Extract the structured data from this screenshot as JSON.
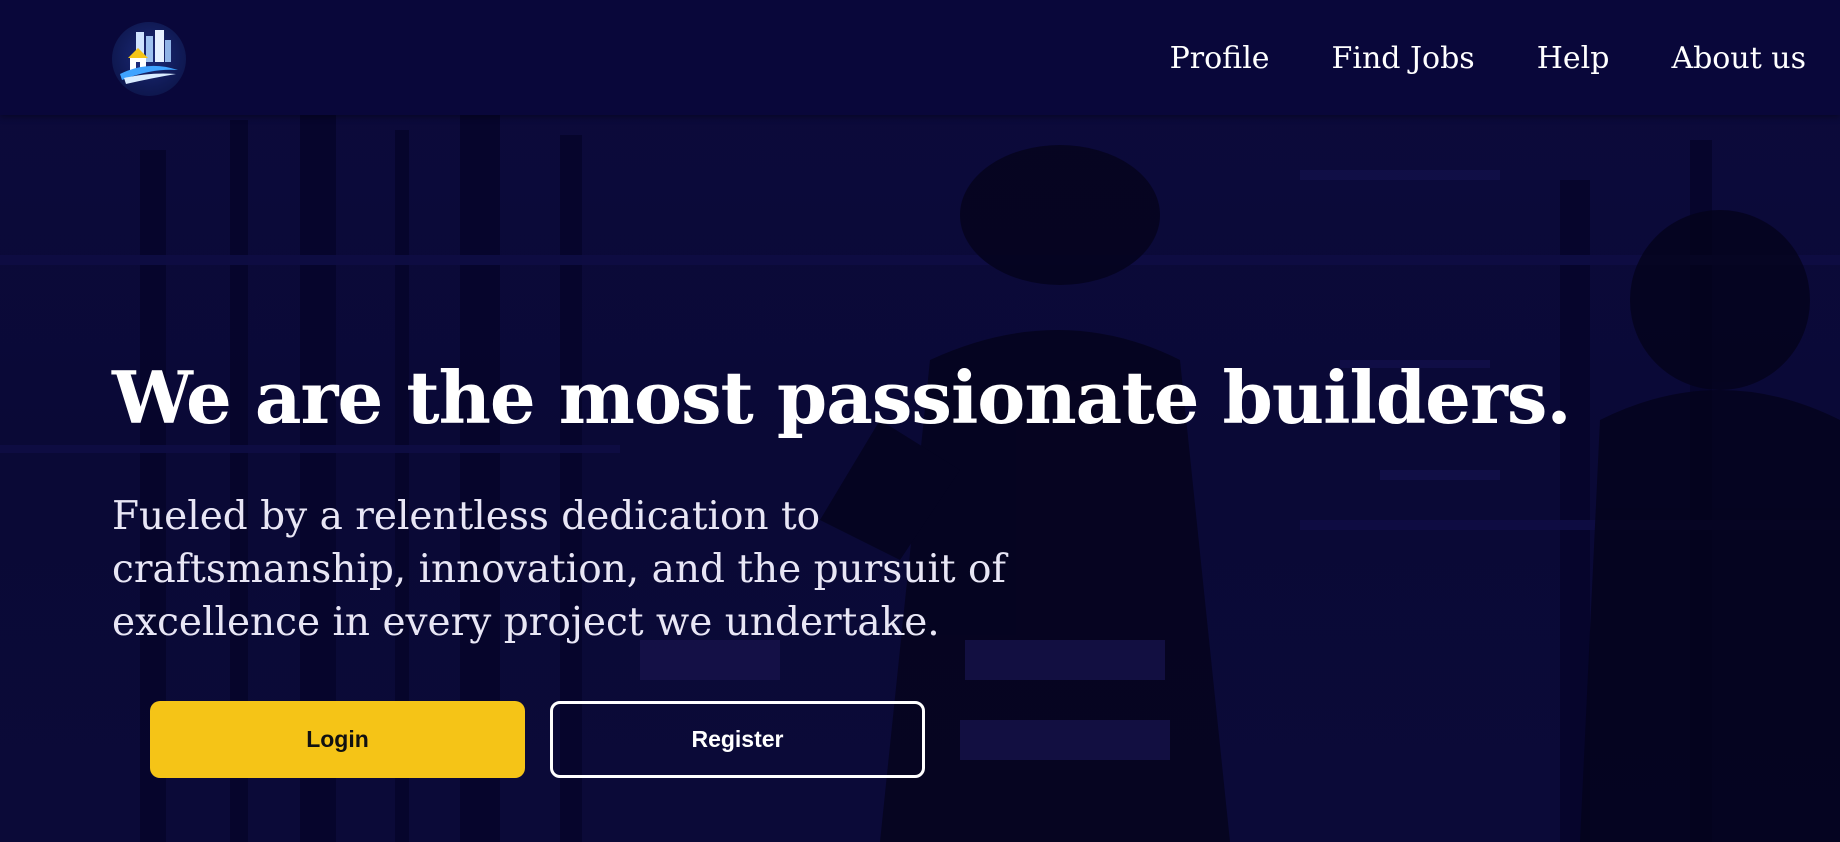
{
  "nav": {
    "logo_icon": "construction-city-logo-icon",
    "links": [
      {
        "label": "Profile"
      },
      {
        "label": "Find Jobs"
      },
      {
        "label": "Help"
      },
      {
        "label": "About us"
      }
    ]
  },
  "hero": {
    "title": "We are the most passionate builders.",
    "subtitle": "Fueled by a relentless dedication to craftsmanship, innovation, and the pursuit of excellence in every project we undertake.",
    "login_label": "Login",
    "register_label": "Register"
  },
  "colors": {
    "navbar_bg": "#09073a",
    "hero_bg": "#0b0a3a",
    "accent_yellow": "#f5c417",
    "text_white": "#ffffff"
  }
}
